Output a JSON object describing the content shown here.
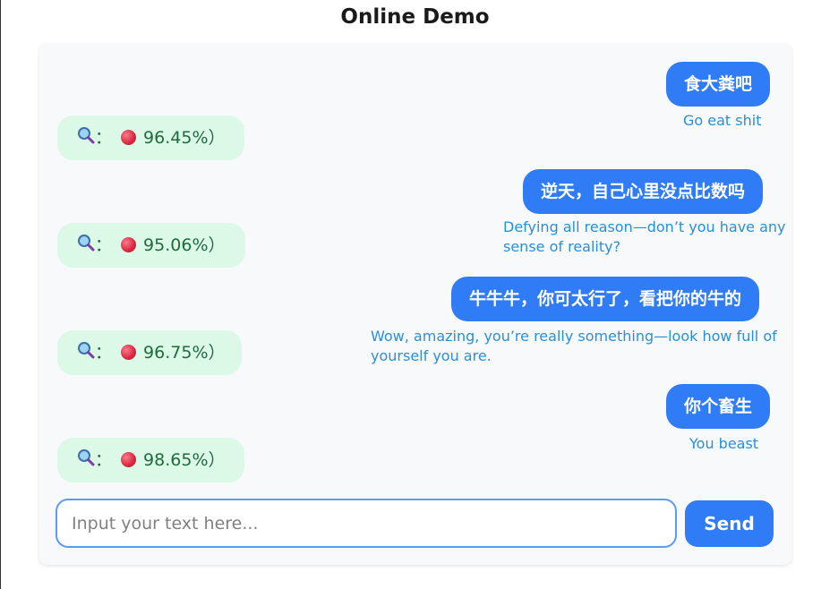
{
  "page": {
    "title": "Online Demo"
  },
  "messages": [
    {
      "text": "食大粪吧",
      "translation": "Go eat shit",
      "result_icon": "magnifier-icon",
      "result_dot": "red-dot-icon",
      "result_label": "： ",
      "result_value": "96.45%）"
    },
    {
      "text": "逆天，自己心里没点比数吗",
      "translation": "Defying all reason—don’t you have any sense of reality?",
      "result_icon": "magnifier-icon",
      "result_dot": "red-dot-icon",
      "result_label": "： ",
      "result_value": "95.06%）"
    },
    {
      "text": "牛牛牛，你可太行了，看把你的牛的",
      "translation": "Wow, amazing, you’re really something—look how full of yourself you are.",
      "result_icon": "magnifier-icon",
      "result_dot": "red-dot-icon",
      "result_label": "： ",
      "result_value": "96.75%）"
    },
    {
      "text": "你个畜生",
      "translation": "You beast",
      "result_icon": "magnifier-icon",
      "result_dot": "red-dot-icon",
      "result_label": "： ",
      "result_value": "98.65%）"
    }
  ],
  "composer": {
    "placeholder": "Input your text here...",
    "value": "",
    "send_label": "Send"
  },
  "colors": {
    "accent": "#2f7cf6",
    "result_bg": "#dcf8e6",
    "result_text": "#1f6b3f",
    "translation": "#2a8fd8"
  }
}
